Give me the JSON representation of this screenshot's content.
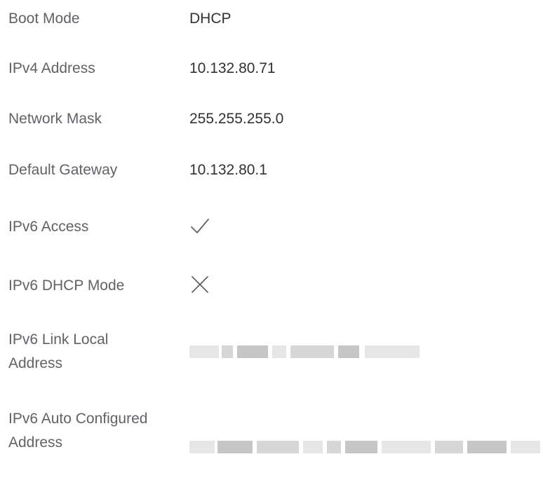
{
  "network_info": {
    "boot_mode": {
      "label": "Boot Mode",
      "value": "DHCP"
    },
    "ipv4_address": {
      "label": "IPv4 Address",
      "value": "10.132.80.71"
    },
    "network_mask": {
      "label": "Network Mask",
      "value": "255.255.255.0"
    },
    "default_gateway": {
      "label": "Default Gateway",
      "value": "10.132.80.1"
    },
    "ipv6_access": {
      "label": "IPv6 Access",
      "icon": "checkmark-icon",
      "enabled": true
    },
    "ipv6_dhcp_mode": {
      "label": "IPv6 DHCP Mode",
      "icon": "cross-icon",
      "enabled": false
    },
    "ipv6_link_local": {
      "label": "IPv6 Link Local Address",
      "value_obscured": true
    },
    "ipv6_auto_configured": {
      "label": "IPv6 Auto Configured Address",
      "value_obscured": true
    }
  },
  "colors": {
    "label_text": "#606266",
    "value_text": "#303133",
    "icon_stroke": "#606266",
    "redaction": "#d6d6d6"
  }
}
